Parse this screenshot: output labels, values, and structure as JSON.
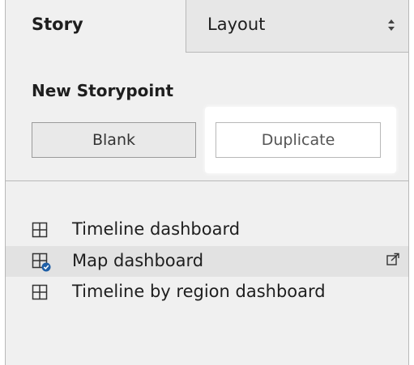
{
  "tabs": {
    "story_label": "Story",
    "layout_label": "Layout"
  },
  "new_storypoint": {
    "title": "New Storypoint",
    "blank_label": "Blank",
    "duplicate_label": "Duplicate"
  },
  "dashboards": [
    {
      "label": "Timeline dashboard",
      "icon": "dashboard-icon",
      "selected": false
    },
    {
      "label": "Map dashboard",
      "icon": "dashboard-in-use-icon",
      "selected": true
    },
    {
      "label": "Timeline by region dashboard",
      "icon": "dashboard-icon",
      "selected": false
    }
  ],
  "colors": {
    "panel_bg": "#f0f0f0",
    "accent_check": "#1f5fa6",
    "highlight": "#ffffff"
  }
}
